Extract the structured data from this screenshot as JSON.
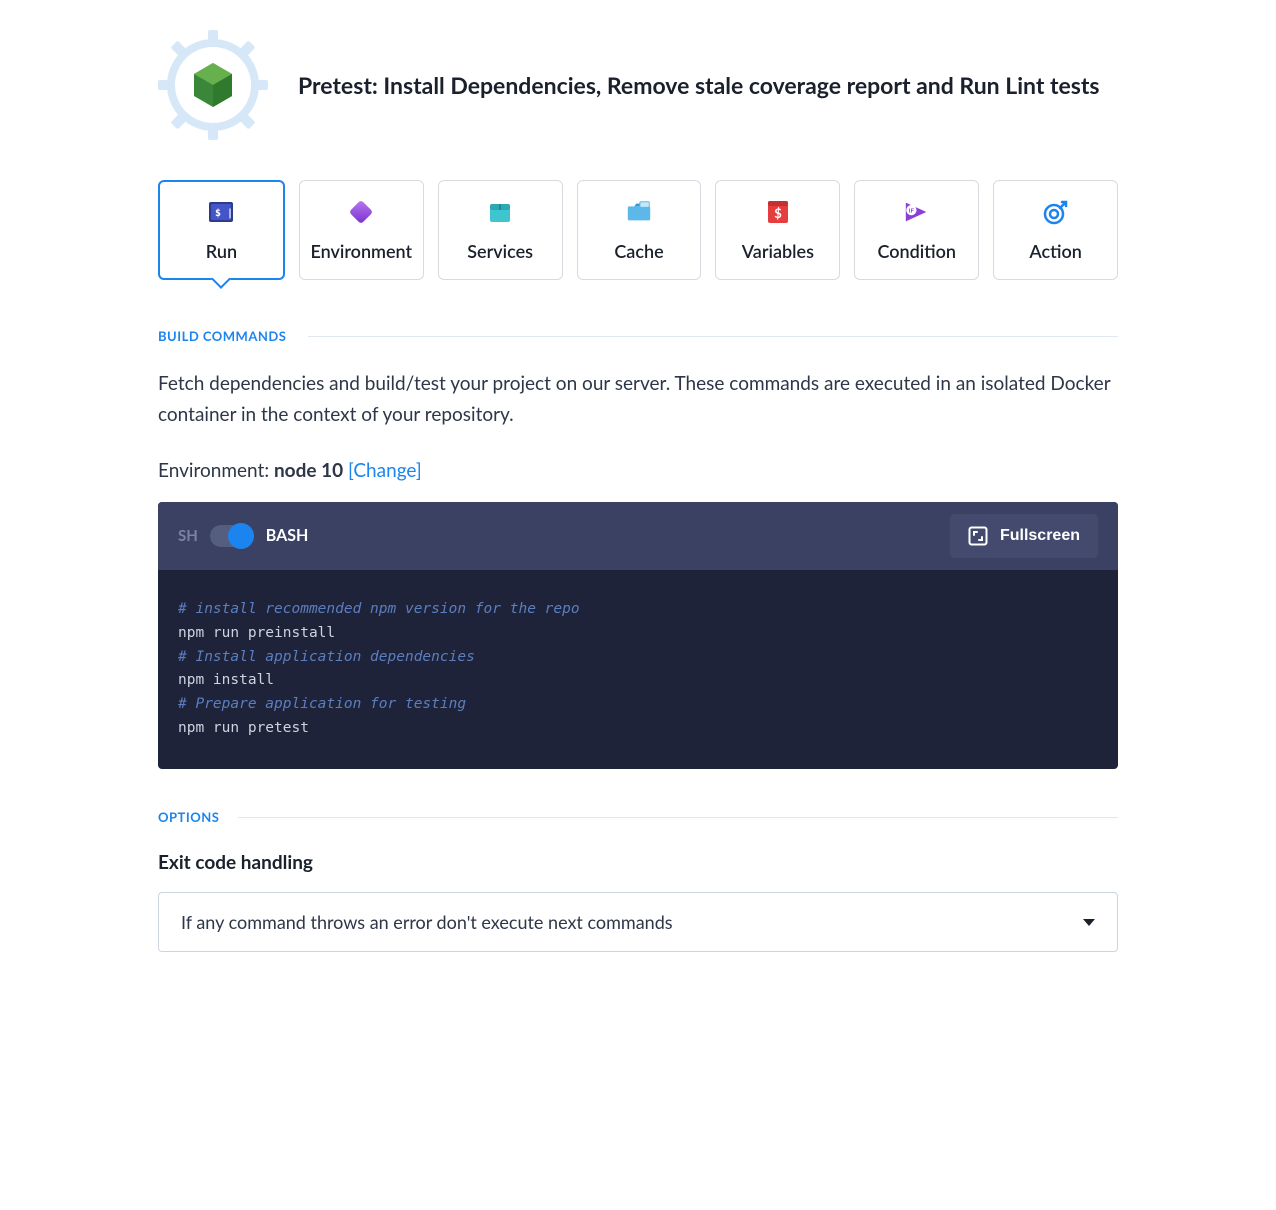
{
  "header": {
    "title": "Pretest: Install Dependencies, Remove stale coverage report and Run Lint tests"
  },
  "tabs": [
    {
      "id": "run",
      "label": "Run",
      "active": true
    },
    {
      "id": "environment",
      "label": "Environment",
      "active": false
    },
    {
      "id": "services",
      "label": "Services",
      "active": false
    },
    {
      "id": "cache",
      "label": "Cache",
      "active": false
    },
    {
      "id": "variables",
      "label": "Variables",
      "active": false
    },
    {
      "id": "condition",
      "label": "Condition",
      "active": false
    },
    {
      "id": "action",
      "label": "Action",
      "active": false
    }
  ],
  "build_commands": {
    "section_label": "BUILD COMMANDS",
    "description": "Fetch dependencies and build/test your project on our server. These commands are executed in an isolated Docker container in the context of your repository.",
    "environment_prefix": "Environment: ",
    "environment_value": "node 10",
    "change_label": "[Change]"
  },
  "code": {
    "sh_label": "SH",
    "bash_label": "BASH",
    "fullscreen_label": "Fullscreen",
    "lines": [
      {
        "text": "# install recommended npm version for the repo",
        "comment": true
      },
      {
        "text": "npm run preinstall",
        "comment": false
      },
      {
        "text": "# Install application dependencies",
        "comment": true
      },
      {
        "text": "npm install",
        "comment": false
      },
      {
        "text": "# Prepare application for testing",
        "comment": true
      },
      {
        "text": "npm run pretest",
        "comment": false
      }
    ]
  },
  "options": {
    "section_label": "OPTIONS",
    "exit_code_label": "Exit code handling",
    "exit_code_value": "If any command throws an error don't execute next commands"
  }
}
